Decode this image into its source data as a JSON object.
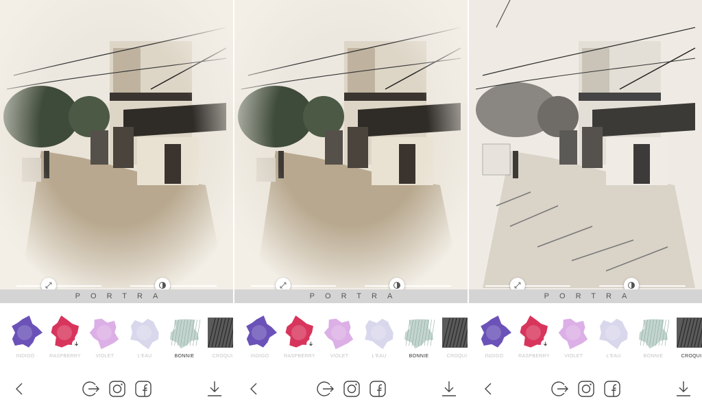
{
  "screens": [
    {
      "filter_name": "PORTRA",
      "active_filter": "BONNIE",
      "download_badge_on": "RASPBERRY",
      "style": "color"
    },
    {
      "filter_name": "PORTRA",
      "active_filter": "BONNIE",
      "download_badge_on": "RASPBERRY",
      "style": "color"
    },
    {
      "filter_name": "PORTRA",
      "active_filter": "CROQUIS",
      "download_badge_on": "RASPBERRY",
      "style": "sketch"
    }
  ],
  "filters": [
    {
      "label": "INDIGO",
      "color": "#5b3fb0"
    },
    {
      "label": "RASPBERRY",
      "color": "#d41f4a"
    },
    {
      "label": "VIOLET",
      "color": "#c57ad6"
    },
    {
      "label": "L'EAU",
      "color": "#b9b6dc"
    },
    {
      "label": "BONNIE",
      "color": "#a9c3bb"
    },
    {
      "label": "CROQUIS",
      "color": "#444444"
    }
  ],
  "toolbar_icons": [
    "back-chevron-icon",
    "share-arrow-icon",
    "instagram-icon",
    "facebook-icon",
    "download-icon"
  ],
  "colors": {
    "namebar_bg": "#d4d4d4",
    "label_inactive": "#c4c4c4",
    "label_active": "#333333"
  }
}
